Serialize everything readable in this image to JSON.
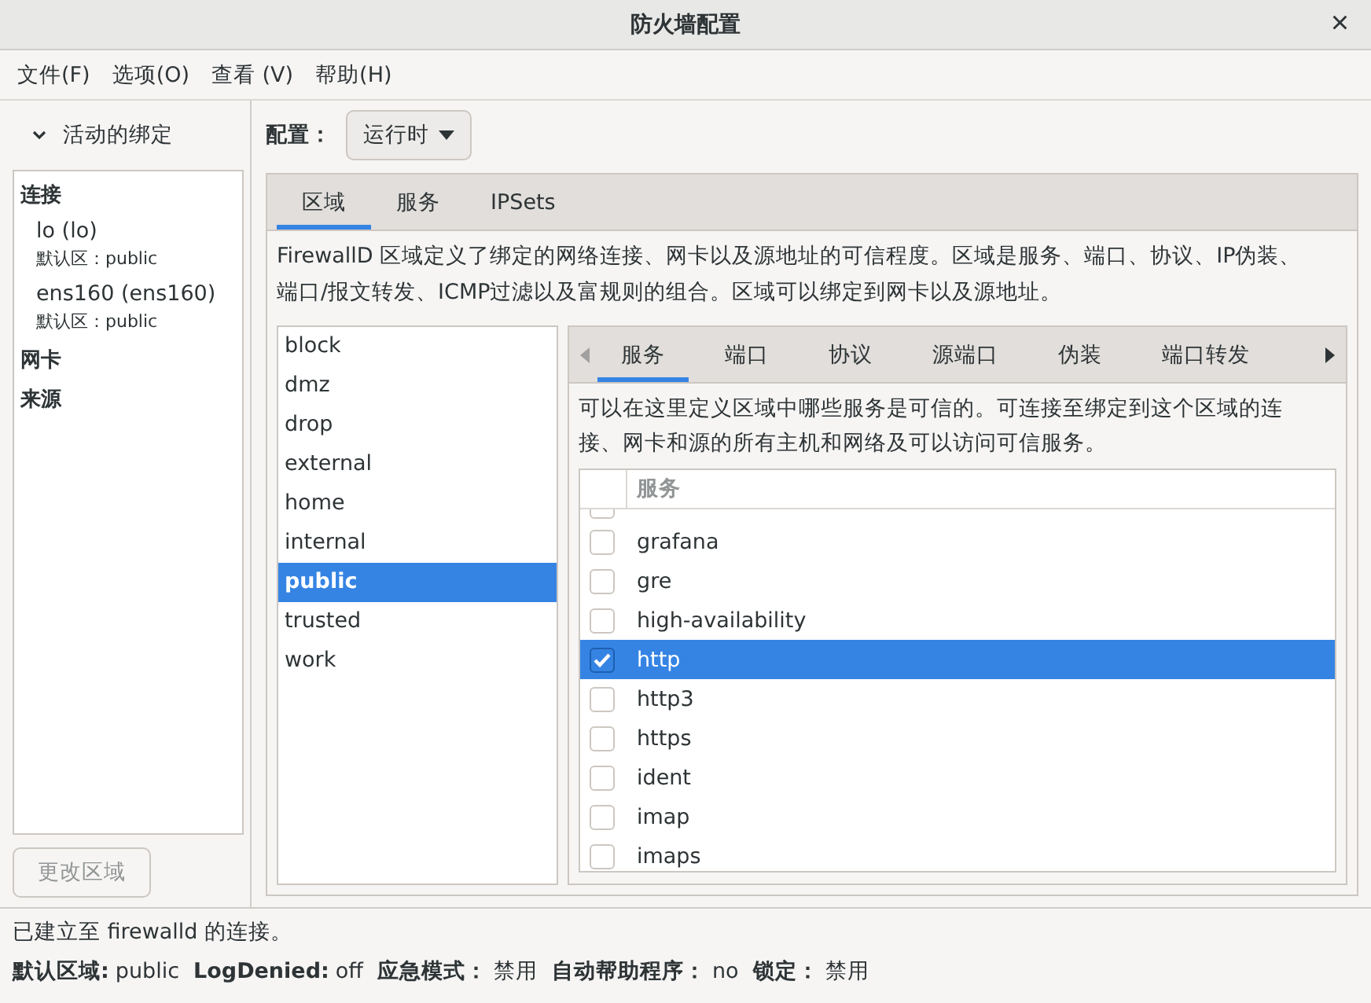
{
  "window": {
    "title": "防火墙配置",
    "close": "×"
  },
  "menu": [
    "文件(F)",
    "选项(O)",
    "查看 (V)",
    "帮助(H)"
  ],
  "sidebar": {
    "header": {
      "label": "活动的绑定",
      "expanded": true
    },
    "sections": [
      {
        "label": "连接",
        "items": [
          {
            "name": "lo (lo)",
            "zone": "默认区：public"
          },
          {
            "name": "ens160 (ens160)",
            "zone": "默认区：public"
          }
        ]
      },
      {
        "label": "网卡"
      },
      {
        "label": "来源"
      }
    ],
    "button": {
      "label": "更改区域",
      "disabled": true
    }
  },
  "config": {
    "label": "配置：",
    "value": "运行时"
  },
  "tabs": [
    {
      "label": "区域",
      "selected": true
    },
    {
      "label": "服务",
      "selected": false
    },
    {
      "label": "IPSets",
      "selected": false
    }
  ],
  "zone_description": "FirewallD 区域定义了绑定的网络连接、网卡以及源地址的可信程度。区域是服务、端口、协议、IP伪装、端口/报文转发、ICMP过滤以及富规则的组合。区域可以绑定到网卡以及源地址。",
  "zones": [
    {
      "label": "block",
      "selected": false
    },
    {
      "label": "dmz",
      "selected": false
    },
    {
      "label": "drop",
      "selected": false
    },
    {
      "label": "external",
      "selected": false
    },
    {
      "label": "home",
      "selected": false
    },
    {
      "label": "internal",
      "selected": false
    },
    {
      "label": "public",
      "selected": true
    },
    {
      "label": "trusted",
      "selected": false
    },
    {
      "label": "work",
      "selected": false
    }
  ],
  "zone_tabs": [
    {
      "label": "服务",
      "selected": true
    },
    {
      "label": "端口",
      "selected": false
    },
    {
      "label": "协议",
      "selected": false
    },
    {
      "label": "源端口",
      "selected": false
    },
    {
      "label": "伪装",
      "selected": false
    },
    {
      "label": "端口转发",
      "selected": false
    }
  ],
  "services_description": "可以在这里定义区域中哪些服务是可信的。可连接至绑定到这个区域的连接、网卡和源的所有主机和网络及可以访问可信服务。",
  "services": {
    "column": "服务",
    "rows": [
      {
        "name": "grafana",
        "checked": false,
        "selected": false
      },
      {
        "name": "gre",
        "checked": false,
        "selected": false
      },
      {
        "name": "high-availability",
        "checked": false,
        "selected": false
      },
      {
        "name": "http",
        "checked": true,
        "selected": true
      },
      {
        "name": "http3",
        "checked": false,
        "selected": false
      },
      {
        "name": "https",
        "checked": false,
        "selected": false
      },
      {
        "name": "ident",
        "checked": false,
        "selected": false
      },
      {
        "name": "imap",
        "checked": false,
        "selected": false
      },
      {
        "name": "imaps",
        "checked": false,
        "selected": false
      }
    ]
  },
  "status_bar": {
    "message": "已建立至 firewalld 的连接。",
    "fields": [
      {
        "label": "默认区域:",
        "value": "public"
      },
      {
        "label": "LogDenied:",
        "value": "off"
      },
      {
        "label": "应急模式：",
        "value": "禁用"
      },
      {
        "label": "自动帮助程序：",
        "value": "no"
      },
      {
        "label": "锁定：",
        "value": "禁用"
      }
    ]
  }
}
